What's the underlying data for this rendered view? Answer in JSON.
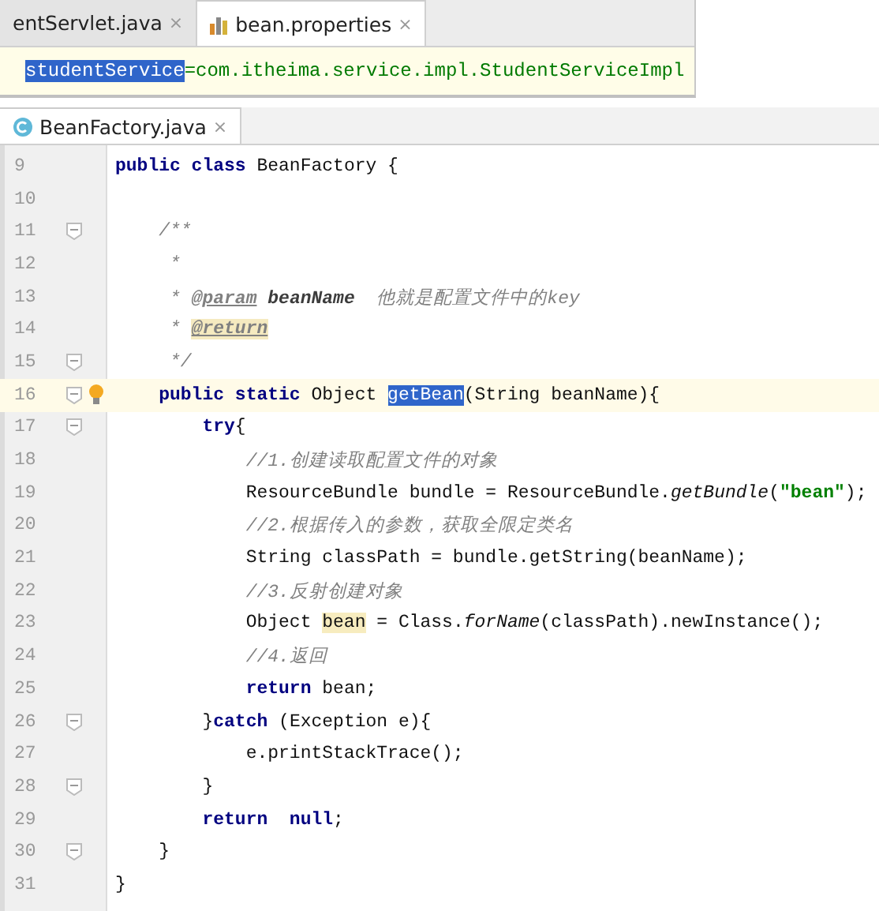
{
  "properties_editor": {
    "tabs": [
      {
        "label": "entServlet.java",
        "close": "×",
        "selected": false,
        "kind": "java"
      },
      {
        "label": "bean.properties",
        "close": "×",
        "selected": true,
        "kind": "properties"
      }
    ],
    "line": [
      {
        "kind": "selected",
        "text": "studentService"
      },
      {
        "kind": "value",
        "text": "=com.itheima.service.impl.StudentServiceImpl"
      }
    ]
  },
  "java_editor": {
    "tabs": [
      {
        "label": "BeanFactory.java",
        "close": "×",
        "selected": true,
        "kind": "class"
      }
    ],
    "lines": [
      {
        "number": "9",
        "fold": false,
        "current": false,
        "bulb": false,
        "tokens": [
          {
            "kind": "kw",
            "text": "public class"
          },
          {
            "kind": "plain",
            "text": " BeanFactory {"
          }
        ]
      },
      {
        "number": "10",
        "fold": false,
        "current": false,
        "bulb": false
      },
      {
        "number": "11",
        "fold": true,
        "current": false,
        "bulb": false,
        "tokens": [
          {
            "kind": "doc",
            "text": "    /**"
          }
        ]
      },
      {
        "number": "12",
        "fold": false,
        "current": false,
        "bulb": false,
        "tokens": [
          {
            "kind": "doc",
            "text": "     *"
          }
        ]
      },
      {
        "number": "13",
        "fold": false,
        "current": false,
        "bulb": false,
        "tokens": [
          {
            "kind": "doc",
            "text": "     * "
          },
          {
            "kind": "doctag",
            "text": "@param"
          },
          {
            "kind": "docparam",
            "text": " beanName"
          },
          {
            "kind": "doc",
            "text": "  他就是配置文件中的key"
          }
        ]
      },
      {
        "number": "14",
        "fold": false,
        "current": false,
        "bulb": false,
        "tokens": [
          {
            "kind": "doc",
            "text": "     * "
          },
          {
            "kind": "doctag-hl",
            "text": "@return"
          }
        ]
      },
      {
        "number": "15",
        "fold": true,
        "current": false,
        "bulb": false,
        "tokens": [
          {
            "kind": "doc",
            "text": "     */"
          }
        ]
      },
      {
        "number": "16",
        "fold": true,
        "current": true,
        "bulb": true,
        "tokens": [
          {
            "kind": "kw",
            "text": "    public static"
          },
          {
            "kind": "plain",
            "text": " Object "
          },
          {
            "kind": "selected",
            "text": "getBean"
          },
          {
            "kind": "plain",
            "text": "(String beanName){"
          }
        ]
      },
      {
        "number": "17",
        "fold": true,
        "current": false,
        "bulb": false,
        "tokens": [
          {
            "kind": "kw",
            "text": "        try"
          },
          {
            "kind": "plain",
            "text": "{"
          }
        ]
      },
      {
        "number": "18",
        "fold": false,
        "current": false,
        "bulb": false,
        "tokens": [
          {
            "kind": "comment",
            "text": "            //1.创建读取配置文件的对象"
          }
        ]
      },
      {
        "number": "19",
        "fold": false,
        "current": false,
        "bulb": false,
        "tokens": [
          {
            "kind": "plain",
            "text": "            ResourceBundle bundle = ResourceBundle."
          },
          {
            "kind": "static",
            "text": "getBundle"
          },
          {
            "kind": "plain",
            "text": "("
          },
          {
            "kind": "string",
            "text": "\"bean\""
          },
          {
            "kind": "plain",
            "text": ");"
          }
        ]
      },
      {
        "number": "20",
        "fold": false,
        "current": false,
        "bulb": false,
        "tokens": [
          {
            "kind": "comment",
            "text": "            //2.根据传入的参数，获取全限定类名"
          }
        ]
      },
      {
        "number": "21",
        "fold": false,
        "current": false,
        "bulb": false,
        "tokens": [
          {
            "kind": "plain",
            "text": "            String classPath = bundle.getString(beanName);"
          }
        ]
      },
      {
        "number": "22",
        "fold": false,
        "current": false,
        "bulb": false,
        "tokens": [
          {
            "kind": "comment",
            "text": "            //3.反射创建对象"
          }
        ]
      },
      {
        "number": "23",
        "fold": false,
        "current": false,
        "bulb": false,
        "tokens": [
          {
            "kind": "plain",
            "text": "            Object "
          },
          {
            "kind": "usage",
            "text": "bean"
          },
          {
            "kind": "plain",
            "text": " = Class."
          },
          {
            "kind": "static",
            "text": "forName"
          },
          {
            "kind": "plain",
            "text": "(classPath).newInstance();"
          }
        ]
      },
      {
        "number": "24",
        "fold": false,
        "current": false,
        "bulb": false,
        "tokens": [
          {
            "kind": "comment",
            "text": "            //4.返回"
          }
        ]
      },
      {
        "number": "25",
        "fold": false,
        "current": false,
        "bulb": false,
        "tokens": [
          {
            "kind": "kw",
            "text": "            return"
          },
          {
            "kind": "plain",
            "text": " bean;"
          }
        ]
      },
      {
        "number": "26",
        "fold": true,
        "current": false,
        "bulb": false,
        "tokens": [
          {
            "kind": "plain",
            "text": "        }"
          },
          {
            "kind": "kw",
            "text": "catch"
          },
          {
            "kind": "plain",
            "text": " (Exception e){"
          }
        ]
      },
      {
        "number": "27",
        "fold": false,
        "current": false,
        "bulb": false,
        "tokens": [
          {
            "kind": "plain",
            "text": "            e.printStackTrace();"
          }
        ]
      },
      {
        "number": "28",
        "fold": true,
        "current": false,
        "bulb": false,
        "tokens": [
          {
            "kind": "plain",
            "text": "        }"
          }
        ]
      },
      {
        "number": "29",
        "fold": false,
        "current": false,
        "bulb": false,
        "tokens": [
          {
            "kind": "kw",
            "text": "        return  null"
          },
          {
            "kind": "plain",
            "text": ";"
          }
        ]
      },
      {
        "number": "30",
        "fold": true,
        "current": false,
        "bulb": false,
        "tokens": [
          {
            "kind": "plain",
            "text": "    }"
          }
        ]
      },
      {
        "number": "31",
        "fold": false,
        "current": false,
        "bulb": false,
        "tokens": [
          {
            "kind": "plain",
            "text": "}"
          }
        ]
      }
    ]
  }
}
